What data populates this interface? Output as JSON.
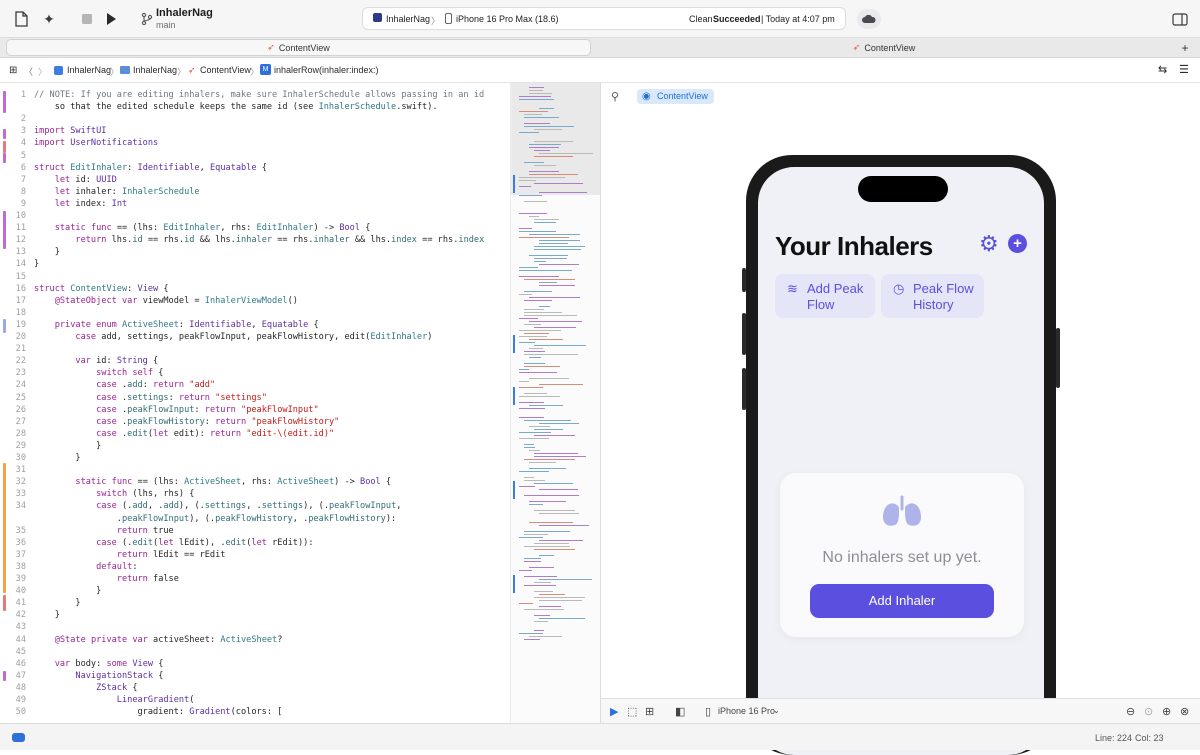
{
  "toolbar": {
    "scheme_name": "InhalerNag",
    "branch": "main",
    "run_destination_app": "InhalerNag",
    "run_destination_device": "iPhone 16 Pro Max (18.6)",
    "build_status_prefix": "Clean",
    "build_status_result": "Succeeded",
    "build_status_time": "| Today at 4:07 pm"
  },
  "tabs": [
    {
      "label": "ContentView"
    },
    {
      "label": "ContentView"
    }
  ],
  "jumpbar": {
    "items": [
      "InhalerNag",
      "InhalerNag",
      "ContentView",
      "inhalerRow(inhaler:index:)"
    ],
    "method_badge": "M"
  },
  "editor": {
    "lines": [
      {
        "n": "1",
        "t": "// NOTE: If you are editing inhalers, make sure InhalerSchedule allows passing in an id"
      },
      {
        "n": "",
        "t": "    so that the edited schedule keeps the same id (see InhalerSchedule.swift)."
      },
      {
        "n": "2",
        "t": ""
      },
      {
        "n": "3",
        "t": "import SwiftUI"
      },
      {
        "n": "4",
        "t": "import UserNotifications"
      },
      {
        "n": "5",
        "t": ""
      },
      {
        "n": "6",
        "t": "struct EditInhaler: Identifiable, Equatable {"
      },
      {
        "n": "7",
        "t": "    let id: UUID"
      },
      {
        "n": "8",
        "t": "    let inhaler: InhalerSchedule"
      },
      {
        "n": "9",
        "t": "    let index: Int"
      },
      {
        "n": "10",
        "t": ""
      },
      {
        "n": "11",
        "t": "    static func == (lhs: EditInhaler, rhs: EditInhaler) -> Bool {"
      },
      {
        "n": "12",
        "t": "        return lhs.id == rhs.id && lhs.inhaler == rhs.inhaler && lhs.index == rhs.index"
      },
      {
        "n": "13",
        "t": "    }"
      },
      {
        "n": "14",
        "t": "}"
      },
      {
        "n": "15",
        "t": ""
      },
      {
        "n": "16",
        "t": "struct ContentView: View {"
      },
      {
        "n": "17",
        "t": "    @StateObject var viewModel = InhalerViewModel()"
      },
      {
        "n": "18",
        "t": ""
      },
      {
        "n": "19",
        "t": "    private enum ActiveSheet: Identifiable, Equatable {"
      },
      {
        "n": "20",
        "t": "        case add, settings, peakFlowInput, peakFlowHistory, edit(EditInhaler)"
      },
      {
        "n": "21",
        "t": ""
      },
      {
        "n": "22",
        "t": "        var id: String {"
      },
      {
        "n": "23",
        "t": "            switch self {"
      },
      {
        "n": "24",
        "t": "            case .add: return \"add\""
      },
      {
        "n": "25",
        "t": "            case .settings: return \"settings\""
      },
      {
        "n": "26",
        "t": "            case .peakFlowInput: return \"peakFlowInput\""
      },
      {
        "n": "27",
        "t": "            case .peakFlowHistory: return \"peakFlowHistory\""
      },
      {
        "n": "28",
        "t": "            case .edit(let edit): return \"edit-\\(edit.id)\""
      },
      {
        "n": "29",
        "t": "            }"
      },
      {
        "n": "30",
        "t": "        }"
      },
      {
        "n": "31",
        "t": ""
      },
      {
        "n": "32",
        "t": "        static func == (lhs: ActiveSheet, rhs: ActiveSheet) -> Bool {"
      },
      {
        "n": "33",
        "t": "            switch (lhs, rhs) {"
      },
      {
        "n": "34",
        "t": "            case (.add, .add), (.settings, .settings), (.peakFlowInput,"
      },
      {
        "n": "",
        "t": "                .peakFlowInput), (.peakFlowHistory, .peakFlowHistory):"
      },
      {
        "n": "35",
        "t": "                return true"
      },
      {
        "n": "36",
        "t": "            case (.edit(let lEdit), .edit(let rEdit)):"
      },
      {
        "n": "37",
        "t": "                return lEdit == rEdit"
      },
      {
        "n": "38",
        "t": "            default:"
      },
      {
        "n": "39",
        "t": "                return false"
      },
      {
        "n": "40",
        "t": "            }"
      },
      {
        "n": "41",
        "t": "        }"
      },
      {
        "n": "42",
        "t": "    }"
      },
      {
        "n": "43",
        "t": ""
      },
      {
        "n": "44",
        "t": "    @State private var activeSheet: ActiveSheet?"
      },
      {
        "n": "45",
        "t": ""
      },
      {
        "n": "46",
        "t": "    var body: some View {"
      },
      {
        "n": "47",
        "t": "        NavigationStack {"
      },
      {
        "n": "48",
        "t": "            ZStack {"
      },
      {
        "n": "49",
        "t": "                LinearGradient("
      },
      {
        "n": "50",
        "t": "                    gradient: Gradient(colors: ["
      }
    ]
  },
  "canvas": {
    "preview_chip": "ContentView",
    "device_label": "iPhone 16 Pro"
  },
  "app": {
    "title": "Your Inhalers",
    "actions": [
      {
        "icon": "peak-flow-icon",
        "label": "Add Peak Flow"
      },
      {
        "icon": "history-icon",
        "label": "Peak Flow History"
      }
    ],
    "empty_message": "No inhalers set up yet.",
    "add_button": "Add Inhaler",
    "accent_color": "#5b4fe0"
  },
  "statusbar": {
    "line": "Line: 224",
    "col": "Col: 23"
  }
}
